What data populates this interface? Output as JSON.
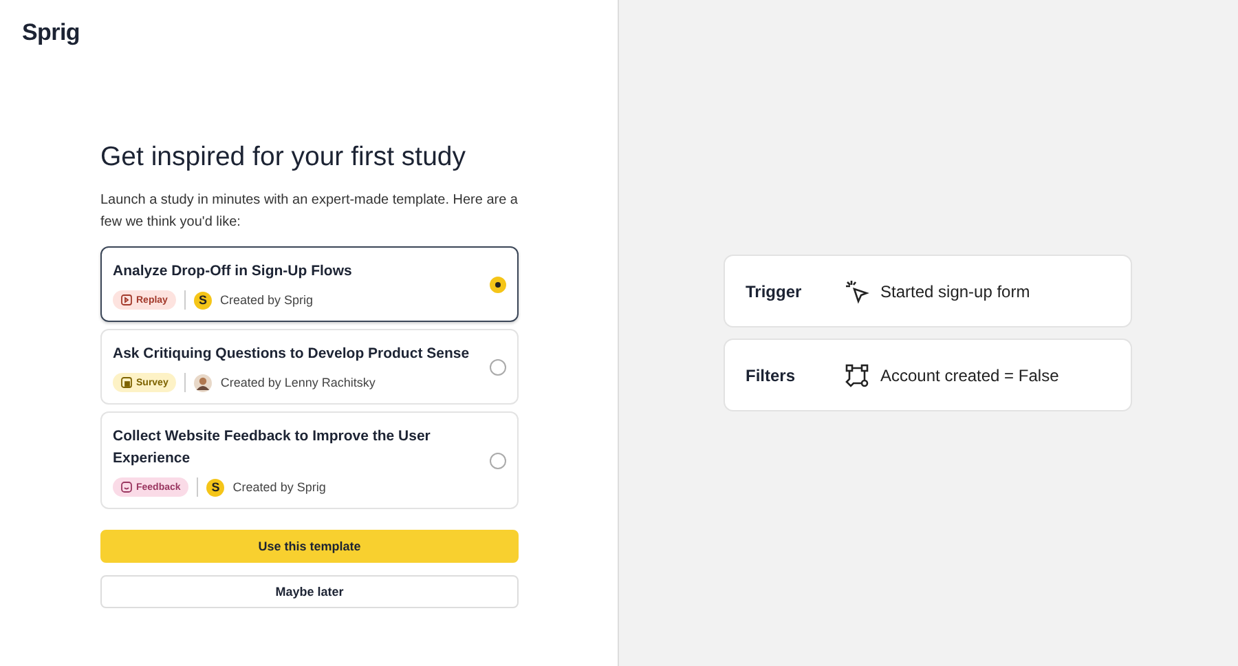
{
  "logo": "Sprig",
  "heading": "Get inspired for your first study",
  "intro": "Launch a study in minutes with an expert-made template. Here are a few we think you'd like:",
  "templates": [
    {
      "title": "Analyze Drop-Off in Sign-Up Flows",
      "tag": {
        "kind": "replay",
        "label": "Replay"
      },
      "author": {
        "kind": "sprig",
        "initial": "S",
        "text": "Created by Sprig"
      },
      "selected": true
    },
    {
      "title": "Ask Critiquing Questions to Develop Product Sense",
      "tag": {
        "kind": "survey",
        "label": "Survey"
      },
      "author": {
        "kind": "person",
        "text": "Created by Lenny Rachitsky"
      },
      "selected": false
    },
    {
      "title": "Collect Website Feedback to Improve the User Experience",
      "tag": {
        "kind": "feedback",
        "label": "Feedback"
      },
      "author": {
        "kind": "sprig",
        "initial": "S",
        "text": "Created by Sprig"
      },
      "selected": false
    }
  ],
  "buttons": [
    {
      "kind": "primary",
      "label": "Use this template"
    },
    {
      "kind": "secondary",
      "label": "Maybe later"
    }
  ],
  "preview": [
    {
      "kind": "trigger",
      "label": "Trigger",
      "value": "Started sign-up form"
    },
    {
      "kind": "filters",
      "label": "Filters",
      "value": "Account created = False"
    }
  ]
}
